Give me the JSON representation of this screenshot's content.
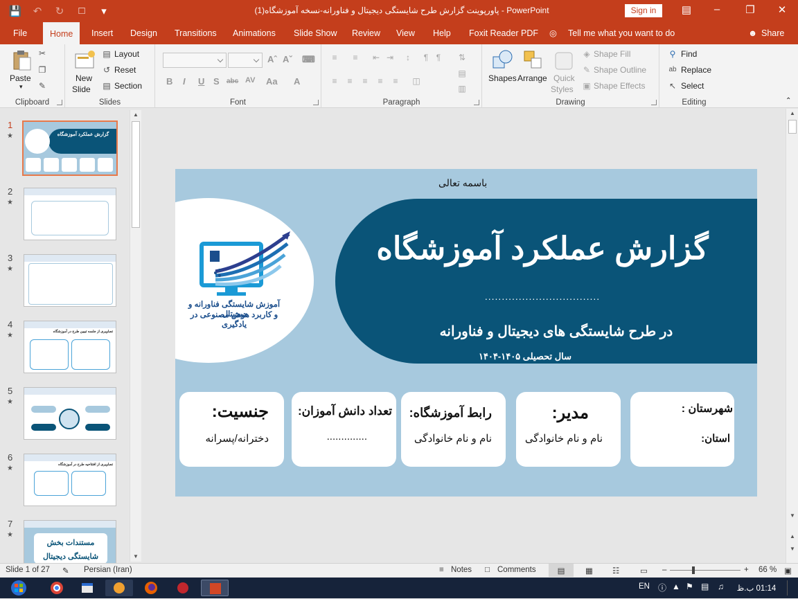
{
  "titlebar": {
    "title": "پاورپوینت گزارش طرح شایستگی دیجیتال و فناورانه-نسخه آموزشگاه(1)  -  PowerPoint",
    "sign_in": "Sign in"
  },
  "tabs": [
    "File",
    "Home",
    "Insert",
    "Design",
    "Transitions",
    "Animations",
    "Slide Show",
    "Review",
    "View",
    "Help",
    "Foxit Reader PDF"
  ],
  "tell_me": "Tell me what you want to do",
  "share": "Share",
  "ribbon": {
    "clipboard": {
      "label": "Clipboard",
      "paste": "Paste"
    },
    "slides": {
      "label": "Slides",
      "new_slide_1": "New",
      "new_slide_2": "Slide",
      "layout": "Layout",
      "reset": "Reset",
      "section": "Section"
    },
    "font": {
      "label": "Font"
    },
    "paragraph": {
      "label": "Paragraph"
    },
    "drawing": {
      "label": "Drawing",
      "shapes": "Shapes",
      "arrange": "Arrange",
      "quick_styles_1": "Quick",
      "quick_styles_2": "Styles",
      "shape_fill": "Shape Fill",
      "shape_outline": "Shape Outline",
      "shape_effects": "Shape Effects"
    },
    "editing": {
      "label": "Editing",
      "find": "Find",
      "replace": "Replace",
      "select": "Select"
    }
  },
  "thumbnails": [
    {
      "num": "1",
      "text": "گزارش عملکرد آموزشگاه"
    },
    {
      "num": "2",
      "text": ""
    },
    {
      "num": "3",
      "text": ""
    },
    {
      "num": "4",
      "text": "تصاویری از جلسه تبیین طرح در آموزشگاه"
    },
    {
      "num": "5",
      "text": ""
    },
    {
      "num": "6",
      "text": "تصاویری از افتتاحیه طرح در آموزشگاه"
    },
    {
      "num": "7",
      "text": "مستندات بخش شایستگی دیجیتال"
    }
  ],
  "slide": {
    "basmala": "باسمه تعالی",
    "title": "گزارش عملکرد آموزشگاه",
    "dots": "..................................",
    "subtitle": "در طرح شایستگی های دیجیتال و فناورانه",
    "year": "سال تحصیلی ۱۴۰۵-۱۴۰۴",
    "logo_line1": "آموزش شایستگی فناورانه و دیجیتال",
    "logo_line2": "و کاربرد هوش مصنوعی در یادگیری",
    "cards": [
      {
        "title": "شهرستان :",
        "value": "استان:"
      },
      {
        "title": "مدیر:",
        "value": "نام و نام خانوادگی"
      },
      {
        "title": "رابط آموزشگاه:",
        "value": "نام و نام خانوادگی"
      },
      {
        "title": "تعداد دانش آموزان:",
        "value": ".............."
      },
      {
        "title": "جنسیت:",
        "value": "دخترانه/پسرانه"
      }
    ]
  },
  "status": {
    "slide_of": "Slide 1 of 27",
    "language": "Persian (Iran)",
    "notes": "Notes",
    "comments": "Comments",
    "zoom": "66 %"
  },
  "taskbar": {
    "lang": "EN",
    "time": "01:14 ب.ظ"
  }
}
